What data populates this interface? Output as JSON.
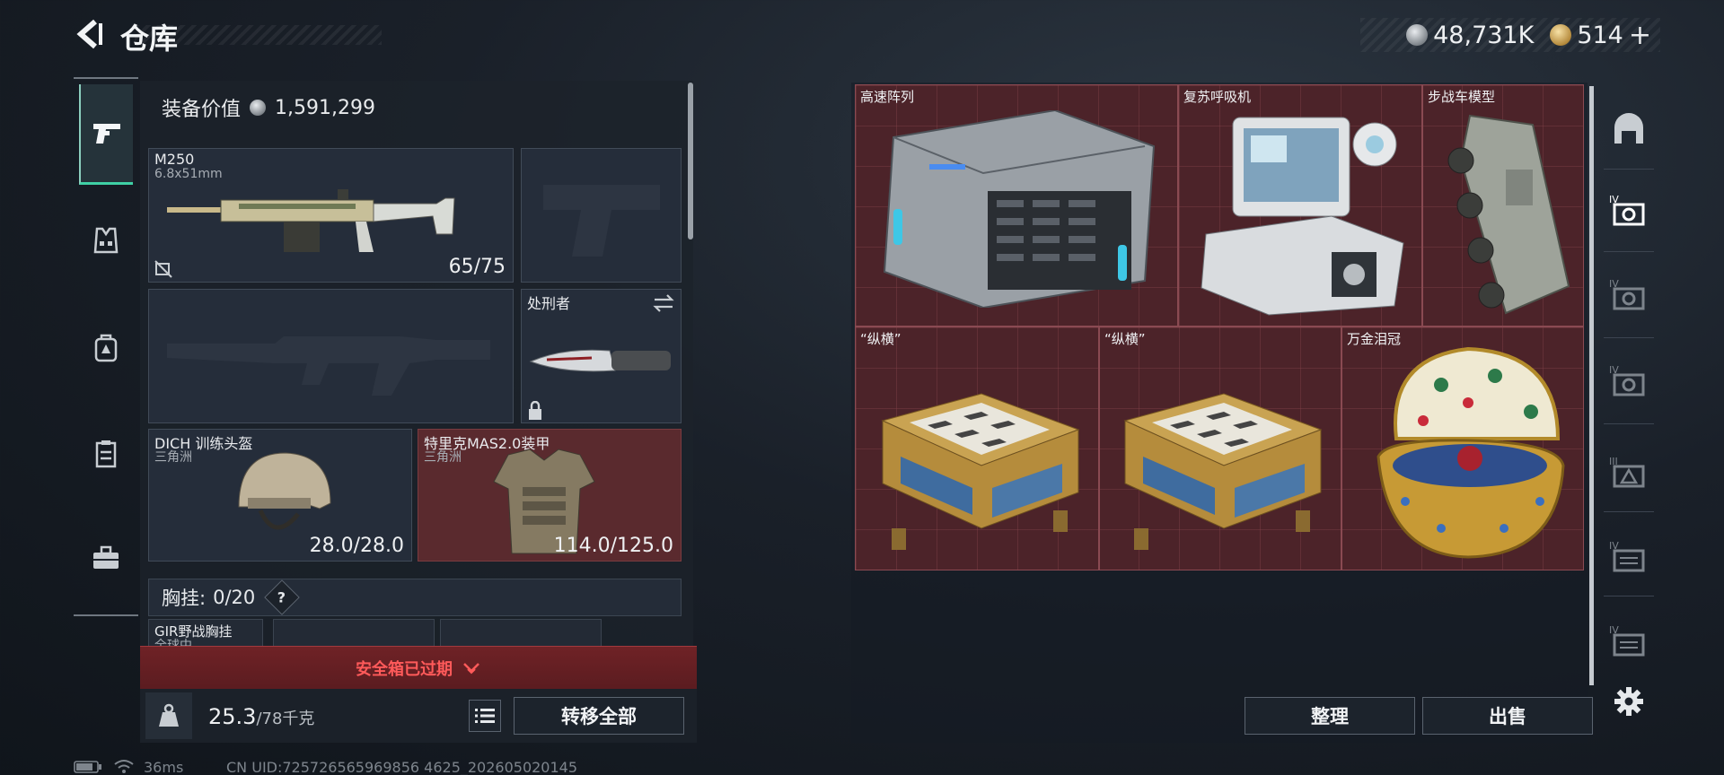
{
  "header": {
    "title": "仓库",
    "currency_silver": "48,731K",
    "currency_gold": "514",
    "plus_label": "+"
  },
  "left_rail": {
    "items": [
      {
        "name": "weapon-tab",
        "icon": "pistol-icon",
        "active": true
      },
      {
        "name": "vest-tab",
        "icon": "vest-icon",
        "active": false
      },
      {
        "name": "backpack-tab",
        "icon": "backpack-icon",
        "active": false
      },
      {
        "name": "rig-tab",
        "icon": "chest-rig-icon",
        "active": false
      },
      {
        "name": "case-tab",
        "icon": "briefcase-icon",
        "active": false
      }
    ]
  },
  "equipment": {
    "value_label": "装备价值",
    "value": "1,591,299",
    "primary_weapon": {
      "name": "M250",
      "caliber": "6.8x51mm",
      "ammo": "65/75"
    },
    "melee": {
      "name": "处刑者"
    },
    "helmet": {
      "name": "DICH 训练头盔",
      "sub": "三角洲",
      "durability": "28.0/28.0"
    },
    "armor": {
      "name": "特里克MAS2.0装甲",
      "sub": "三角洲",
      "durability": "114.0/125.0"
    },
    "chest_rig": {
      "label": "胸挂:",
      "count": "0/20",
      "help": "?"
    },
    "chest_rig_item": {
      "name": "GIR野战胸挂",
      "sub": "全球中"
    }
  },
  "safe_box": {
    "expired_text": "安全箱已过期"
  },
  "footer": {
    "weight_current": "25.3",
    "weight_max": "/78千克",
    "transfer_all": "转移全部",
    "sort": "整理",
    "sell": "出售"
  },
  "stash": {
    "items": [
      {
        "label": "高速阵列",
        "icon": "server-array-icon"
      },
      {
        "label": "复苏呼吸机",
        "icon": "ventilator-icon"
      },
      {
        "label": "步战车模型",
        "icon": "ifv-model-icon"
      },
      {
        "label": "“纵横”",
        "icon": "chess-box-icon"
      },
      {
        "label": "“纵横”",
        "icon": "chess-box-icon"
      },
      {
        "label": "万金泪冠",
        "icon": "jeweled-egg-icon"
      }
    ]
  },
  "right_rail": {
    "items": [
      "arch-icon",
      "stash-iv-icon",
      "stash-iv-icon",
      "stash-iv-icon",
      "stash-iii-icon",
      "stash-iv-icon",
      "stash-iv-icon"
    ]
  },
  "status_bar": {
    "ping": "36ms",
    "uid": "CN UID:725726565969856 4625_202605020145"
  },
  "colors": {
    "accent_green": "#3fd0a5",
    "warning_red": "#ff5a5a",
    "stash_bg": "#4c2329"
  }
}
